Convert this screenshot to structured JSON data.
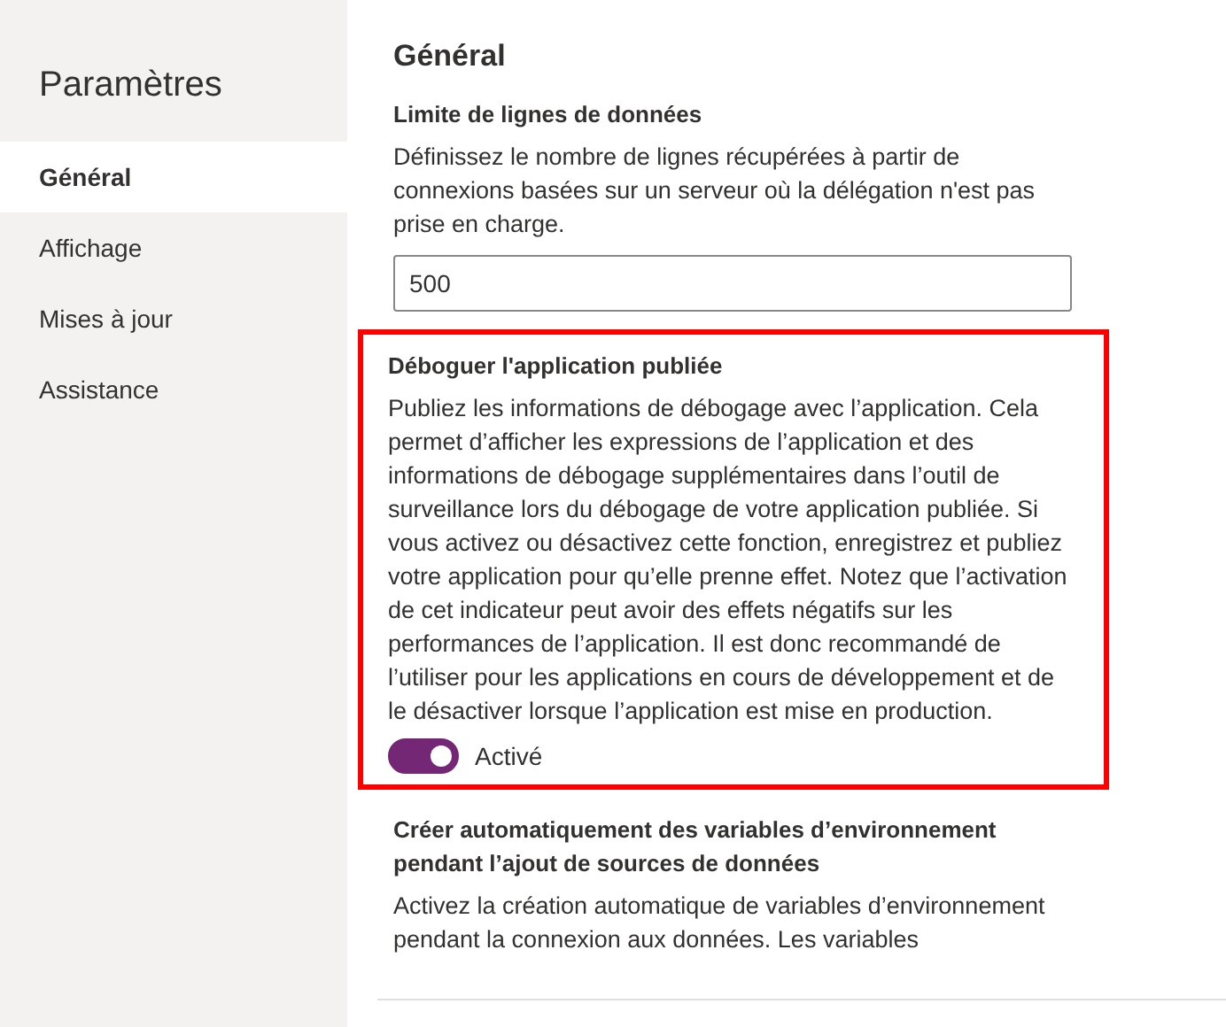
{
  "sidebar": {
    "title": "Paramètres",
    "items": [
      {
        "label": "Général",
        "selected": true
      },
      {
        "label": "Affichage",
        "selected": false
      },
      {
        "label": "Mises à jour",
        "selected": false
      },
      {
        "label": "Assistance",
        "selected": false
      }
    ]
  },
  "main": {
    "title": "Général",
    "sections": [
      {
        "kind": "input",
        "heading": "Limite de lignes de données",
        "description": "Définissez le nombre de lignes récupérées à partir de connexions basées sur un serveur où la délégation n'est pas prise en charge.",
        "value": "500",
        "highlighted": false
      },
      {
        "kind": "toggle",
        "heading": "Déboguer l'application publiée",
        "description": "Publiez les informations de débogage avec l’application. Cela permet d’afficher les expressions de l’application et des informations de débogage supplémentaires dans l’outil de surveillance lors du débogage de votre application publiée. Si vous activez ou désactivez cette fonction, enregistrez et publiez votre application pour qu’elle prenne effet. Notez que l’activation de cet indicateur peut avoir des effets négatifs sur les performances de l’application. Il est donc recommandé de l’utiliser pour les applications en cours de développement et de le désactiver lorsque l’application est mise en production.",
        "on": true,
        "toggle_label": "Activé",
        "highlighted": true
      },
      {
        "kind": "text",
        "heading": "Créer automatiquement des variables d’environnement pendant l’ajout de sources de données",
        "description": "Activez la création automatique de variables d’environnement pendant la connexion aux données. Les variables",
        "highlighted": false
      }
    ]
  }
}
